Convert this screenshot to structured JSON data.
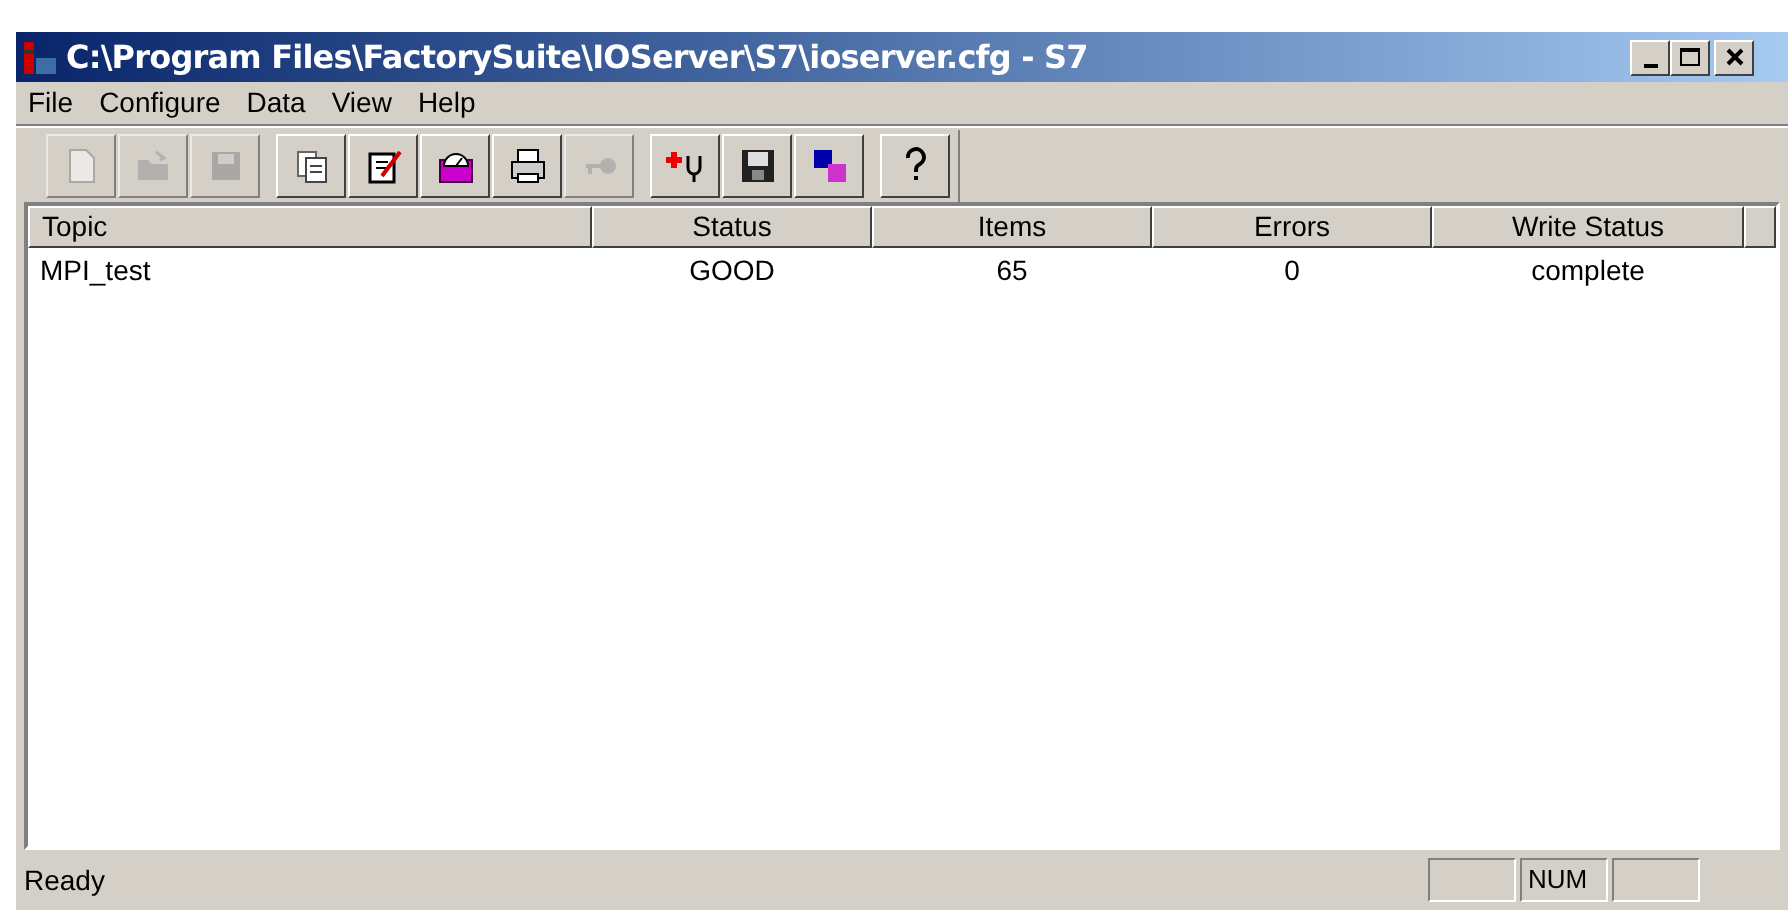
{
  "window": {
    "title": "C:\\Program Files\\FactorySuite\\IOServer\\S7\\ioserver.cfg - S7"
  },
  "menu": [
    "File",
    "Configure",
    "Data",
    "View",
    "Help"
  ],
  "toolbar": [
    {
      "kind": "new",
      "disabled": true
    },
    {
      "kind": "open",
      "disabled": true
    },
    {
      "kind": "save",
      "disabled": true
    },
    {
      "kind": "copy",
      "disabled": false
    },
    {
      "kind": "edit",
      "disabled": false
    },
    {
      "kind": "gauge",
      "disabled": false
    },
    {
      "kind": "print",
      "disabled": false
    },
    {
      "kind": "key",
      "disabled": true
    },
    {
      "kind": "diagnose",
      "disabled": false
    },
    {
      "kind": "disk",
      "disabled": false
    },
    {
      "kind": "blocks",
      "disabled": false
    },
    {
      "kind": "help",
      "disabled": false
    }
  ],
  "table": {
    "columns": [
      "Topic",
      "Status",
      "Items",
      "Errors",
      "Write Status"
    ],
    "rows": [
      [
        "MPI_test",
        "GOOD",
        "65",
        "0",
        "complete"
      ]
    ]
  },
  "status_bar": {
    "message": "Ready",
    "indicator": "NUM"
  }
}
